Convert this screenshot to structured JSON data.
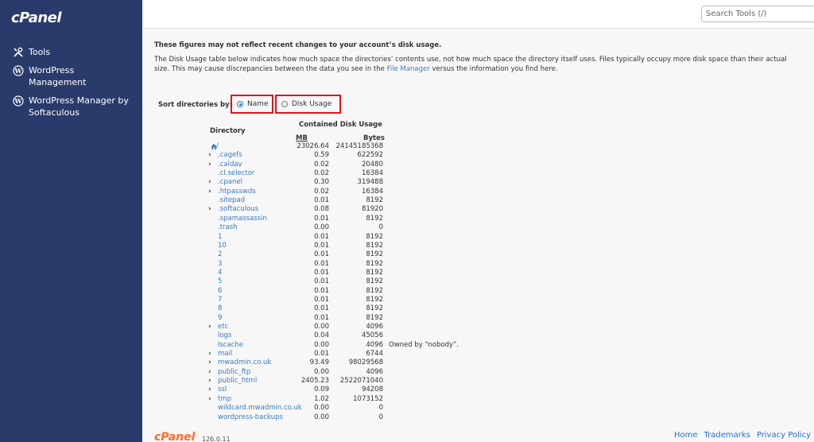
{
  "app": {
    "logo": "cPanel",
    "version": "126.0.11"
  },
  "sidebar": {
    "items": [
      {
        "label": "Tools",
        "icon": "tools-icon"
      },
      {
        "label": "WordPress Management",
        "icon": "wordpress-icon"
      },
      {
        "label": "WordPress Manager by Softaculous",
        "icon": "wordpress-icon"
      }
    ]
  },
  "search": {
    "placeholder": "Search Tools (/)"
  },
  "notice": {
    "title": "These figures may not reflect recent changes to your account’s disk usage.",
    "text_before": "The Disk Usage table below indicates how much space the directories’ contents use, not how much space the directory itself uses. Files typically occupy more disk space than their actual size. This may cause discrepancies between the data you see in the ",
    "link": "File Manager",
    "text_after": " versus the information you find here."
  },
  "sort": {
    "label": "Sort directories by:",
    "options": [
      {
        "label": "Name",
        "selected": true
      },
      {
        "label": "Disk Usage",
        "selected": false
      }
    ]
  },
  "table": {
    "directory_header": "Directory",
    "usage_header": "Contained Disk Usage",
    "mb_header": "MB",
    "bytes_header": "Bytes",
    "rows": [
      {
        "name": "/",
        "mb": "23026.64",
        "bytes": "24145185368",
        "expandable": false,
        "home": true,
        "note": ""
      },
      {
        "name": ".cagefs",
        "mb": "0.59",
        "bytes": "622592",
        "expandable": true,
        "home": false,
        "note": ""
      },
      {
        "name": ".caldav",
        "mb": "0.02",
        "bytes": "20480",
        "expandable": true,
        "home": false,
        "note": ""
      },
      {
        "name": ".cl.selector",
        "mb": "0.02",
        "bytes": "16384",
        "expandable": false,
        "home": false,
        "note": ""
      },
      {
        "name": ".cpanel",
        "mb": "0.30",
        "bytes": "319488",
        "expandable": true,
        "home": false,
        "note": ""
      },
      {
        "name": ".htpasswds",
        "mb": "0.02",
        "bytes": "16384",
        "expandable": true,
        "home": false,
        "note": ""
      },
      {
        "name": ".sitepad",
        "mb": "0.01",
        "bytes": "8192",
        "expandable": false,
        "home": false,
        "note": ""
      },
      {
        "name": ".softaculous",
        "mb": "0.08",
        "bytes": "81920",
        "expandable": true,
        "home": false,
        "note": ""
      },
      {
        "name": ".spamassassin",
        "mb": "0.01",
        "bytes": "8192",
        "expandable": false,
        "home": false,
        "note": ""
      },
      {
        "name": ".trash",
        "mb": "0.00",
        "bytes": "0",
        "expandable": false,
        "home": false,
        "note": ""
      },
      {
        "name": "1",
        "mb": "0.01",
        "bytes": "8192",
        "expandable": false,
        "home": false,
        "note": ""
      },
      {
        "name": "10",
        "mb": "0.01",
        "bytes": "8192",
        "expandable": false,
        "home": false,
        "note": ""
      },
      {
        "name": "2",
        "mb": "0.01",
        "bytes": "8192",
        "expandable": false,
        "home": false,
        "note": ""
      },
      {
        "name": "3",
        "mb": "0.01",
        "bytes": "8192",
        "expandable": false,
        "home": false,
        "note": ""
      },
      {
        "name": "4",
        "mb": "0.01",
        "bytes": "8192",
        "expandable": false,
        "home": false,
        "note": ""
      },
      {
        "name": "5",
        "mb": "0.01",
        "bytes": "8192",
        "expandable": false,
        "home": false,
        "note": ""
      },
      {
        "name": "6",
        "mb": "0.01",
        "bytes": "8192",
        "expandable": false,
        "home": false,
        "note": ""
      },
      {
        "name": "7",
        "mb": "0.01",
        "bytes": "8192",
        "expandable": false,
        "home": false,
        "note": ""
      },
      {
        "name": "8",
        "mb": "0.01",
        "bytes": "8192",
        "expandable": false,
        "home": false,
        "note": ""
      },
      {
        "name": "9",
        "mb": "0.01",
        "bytes": "8192",
        "expandable": false,
        "home": false,
        "note": ""
      },
      {
        "name": "etc",
        "mb": "0.00",
        "bytes": "4096",
        "expandable": true,
        "home": false,
        "note": ""
      },
      {
        "name": "logs",
        "mb": "0.04",
        "bytes": "45056",
        "expandable": false,
        "home": false,
        "note": ""
      },
      {
        "name": "lscache",
        "mb": "0.00",
        "bytes": "4096",
        "expandable": false,
        "home": false,
        "note": "Owned by “nobody”."
      },
      {
        "name": "mail",
        "mb": "0.01",
        "bytes": "6744",
        "expandable": true,
        "home": false,
        "note": ""
      },
      {
        "name": "mwadmin.co.uk",
        "mb": "93.49",
        "bytes": "98029568",
        "expandable": true,
        "home": false,
        "note": ""
      },
      {
        "name": "public_ftp",
        "mb": "0.00",
        "bytes": "4096",
        "expandable": true,
        "home": false,
        "note": ""
      },
      {
        "name": "public_html",
        "mb": "2405.23",
        "bytes": "2522071040",
        "expandable": true,
        "home": false,
        "note": ""
      },
      {
        "name": "ssl",
        "mb": "0.09",
        "bytes": "94208",
        "expandable": true,
        "home": false,
        "note": ""
      },
      {
        "name": "tmp",
        "mb": "1.02",
        "bytes": "1073152",
        "expandable": true,
        "home": false,
        "note": ""
      },
      {
        "name": "wildcard.mwadmin.co.uk",
        "mb": "0.00",
        "bytes": "0",
        "expandable": false,
        "home": false,
        "note": ""
      },
      {
        "name": "wordpress-backups",
        "mb": "0.00",
        "bytes": "0",
        "expandable": false,
        "home": false,
        "note": ""
      }
    ]
  },
  "footer": {
    "links": [
      "Home",
      "Trademarks",
      "Privacy Policy"
    ]
  }
}
